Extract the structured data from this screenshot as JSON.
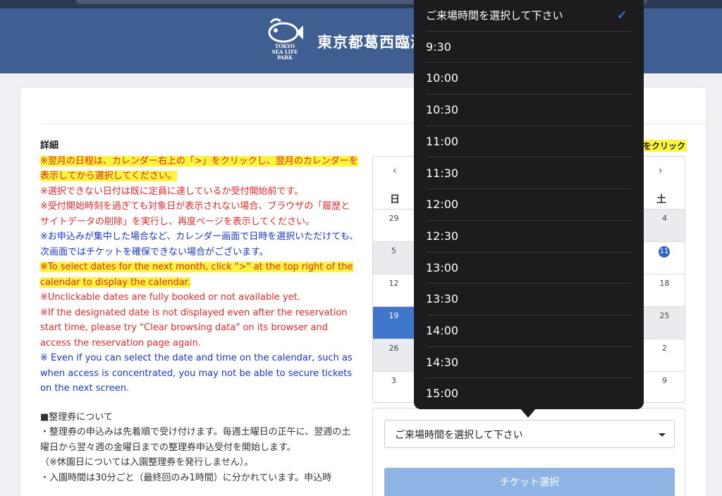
{
  "header": {
    "site_name": "東京都葛西臨海",
    "logo_text_line1": "TOKYO",
    "logo_text_line2": "SEA LIFE",
    "logo_text_line3": "PARK"
  },
  "details": {
    "heading": "詳細",
    "note1": "※翌月の日程は、カレンダー右上の「>」をクリックし、翌月のカレンダーを表示してから選択してください。",
    "note2": "※選択できない日付は既に定員に達しているか受付開始前です。",
    "note3": "※受付開始時刻を過ぎても対象日が表示されない場合、ブラウザの「履歴とサイトデータの削除」を実行し、再度ページを表示してください。",
    "note4": "※お申込みが集中した場合など、カレンダー画面で日時を選択いただけても、次画面ではチケットを確保できない場合がございます。",
    "note5": "※To select dates for the next month, click \">\" at the top right of the calendar to display the calendar.",
    "note6": "※Unclickable dates are fully booked or not available yet.",
    "note7": "※If the designated date is not displayed even after the reservation start time, please try \"Clear browsing data\" on its browser and access the reservation page again.",
    "note8": "※ Even if you can select the date and time on the calendar, such as when access is concentrated, you may not be able to secure tickets on the next screen.",
    "ticket_heading": "■整理券について",
    "ticket1": "・整理券の申込みは先着順で受け付けます。毎週土曜日の正午に、翌週の土曜日から翌々週の金曜日までの整理券申込受付を開始します。",
    "ticket2": "（※休園日については入園整理券を発行しません）。",
    "ticket3": "・入園時間は30分ごと（最終回のみ1時間）に分かれています。申込時"
  },
  "click_hint": "をクリック",
  "calendar": {
    "prev": "‹",
    "next": "›",
    "sun": "日",
    "sat": "土",
    "left_col": [
      "29",
      "5",
      "12",
      "19",
      "26",
      "3"
    ],
    "right_col": [
      "4",
      "11",
      "18",
      "25",
      "2",
      "9"
    ]
  },
  "select": {
    "value": "ご来場時間を選択して下さい"
  },
  "ticket_button": "チケット選択",
  "dropdown": {
    "options": [
      "ご来場時間を選択して下さい",
      "9:30",
      "10:00",
      "10:30",
      "11:00",
      "11:30",
      "12:00",
      "12:30",
      "13:00",
      "13:30",
      "14:00",
      "14:30",
      "15:00"
    ],
    "check": "✓"
  },
  "colors": {
    "header": "#3f5f93",
    "red_note": "#e2292b",
    "blue_note": "#1a35c9",
    "highlight": "#fff43d",
    "selected_day": "#3e77cc",
    "dropdown_bg": "#1c1c1e"
  }
}
